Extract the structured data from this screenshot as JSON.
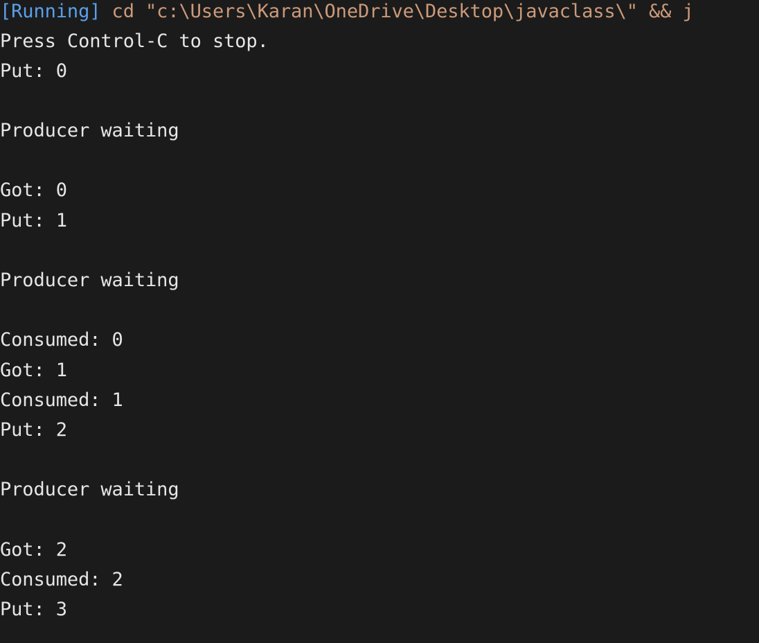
{
  "output": {
    "running_tag": "[Running]",
    "command": " cd \"c:\\Users\\Karan\\OneDrive\\Desktop\\javaclass\\\" && j",
    "lines": [
      "Press Control-C to stop.",
      "Put: 0",
      "Producer waiting",
      "Got: 0",
      "Put: 1",
      "Producer waiting",
      "Consumed: 0",
      "Got: 1",
      "Consumed: 1",
      "Put: 2",
      "Producer waiting",
      "Got: 2",
      "Consumed: 2",
      "Put: 3"
    ]
  },
  "colors": {
    "background": "#1b1b1b",
    "text": "#e6e6e6",
    "running_tag": "#5aa0ea",
    "command": "#cc9a7a"
  }
}
